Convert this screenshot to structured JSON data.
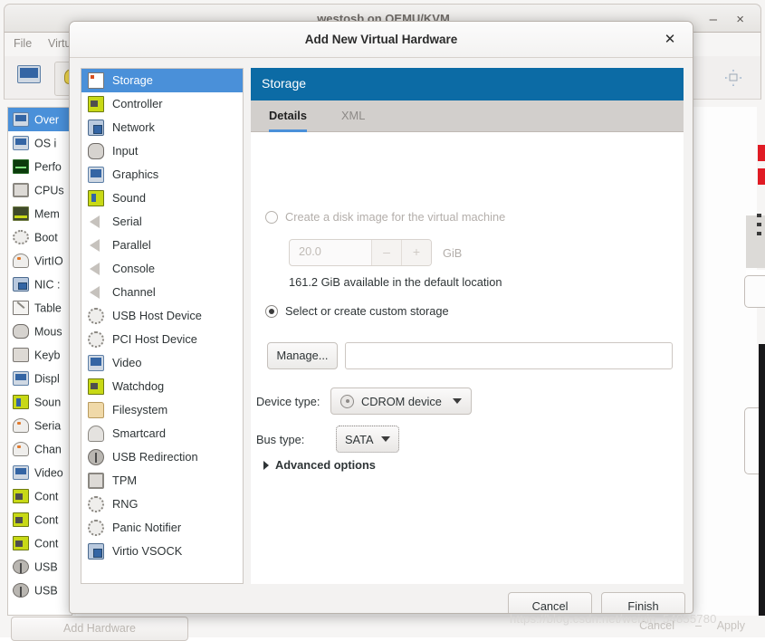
{
  "background_window": {
    "title": "westosb on QEMU/KVM",
    "minimize_label": "–",
    "close_label": "×",
    "menus": [
      "File",
      "Virtu"
    ],
    "toolbar_icons": [
      "monitor-icon",
      "lightbulb-icon",
      "fullscreen-icon"
    ],
    "hardware_list": [
      {
        "label": "Over",
        "icon": "monitor-icon",
        "selected": true
      },
      {
        "label": "OS i",
        "icon": "monitor-icon",
        "selected": false
      },
      {
        "label": "Perfo",
        "icon": "performance-icon",
        "selected": false
      },
      {
        "label": "CPUs",
        "icon": "cpu-chip-icon",
        "selected": false
      },
      {
        "label": "Mem",
        "icon": "memory-icon",
        "selected": false
      },
      {
        "label": "Boot",
        "icon": "gears-icon",
        "selected": false
      },
      {
        "label": "VirtIO",
        "icon": "disk-icon",
        "selected": false
      },
      {
        "label": "NIC :",
        "icon": "network-icon",
        "selected": false
      },
      {
        "label": "Table",
        "icon": "tablet-icon",
        "selected": false
      },
      {
        "label": "Mous",
        "icon": "mouse-icon",
        "selected": false
      },
      {
        "label": "Keyb",
        "icon": "keyboard-icon",
        "selected": false
      },
      {
        "label": "Displ",
        "icon": "monitor-icon",
        "selected": false
      },
      {
        "label": "Soun",
        "icon": "sound-icon",
        "selected": false
      },
      {
        "label": "Seria",
        "icon": "serial-icon",
        "selected": false
      },
      {
        "label": "Chan",
        "icon": "channel-icon",
        "selected": false
      },
      {
        "label": "Video",
        "icon": "monitor-icon",
        "selected": false
      },
      {
        "label": "Cont",
        "icon": "controller-icon",
        "selected": false
      },
      {
        "label": "Cont",
        "icon": "controller-icon",
        "selected": false
      },
      {
        "label": "Cont",
        "icon": "controller-icon",
        "selected": false
      },
      {
        "label": "USB",
        "icon": "usb-icon",
        "selected": false
      },
      {
        "label": "USB",
        "icon": "usb-icon",
        "selected": false
      }
    ],
    "add_hardware_label": "Add Hardware",
    "cancel_label": "Cancel",
    "apply_label": "Apply",
    "apply_prefix": "–"
  },
  "dialog": {
    "title": "Add New Virtual Hardware",
    "close_label": "✕",
    "hardware_types": [
      {
        "label": "Storage",
        "icon": "storage-icon",
        "selected": true
      },
      {
        "label": "Controller",
        "icon": "controller-icon",
        "selected": false
      },
      {
        "label": "Network",
        "icon": "network-icon",
        "selected": false
      },
      {
        "label": "Input",
        "icon": "mouse-icon",
        "selected": false
      },
      {
        "label": "Graphics",
        "icon": "monitor-icon",
        "selected": false
      },
      {
        "label": "Sound",
        "icon": "sound-icon",
        "selected": false
      },
      {
        "label": "Serial",
        "icon": "speaker-icon",
        "selected": false
      },
      {
        "label": "Parallel",
        "icon": "speaker-icon",
        "selected": false
      },
      {
        "label": "Console",
        "icon": "speaker-icon",
        "selected": false
      },
      {
        "label": "Channel",
        "icon": "speaker-icon",
        "selected": false
      },
      {
        "label": "USB Host Device",
        "icon": "gears-icon",
        "selected": false
      },
      {
        "label": "PCI Host Device",
        "icon": "gears-icon",
        "selected": false
      },
      {
        "label": "Video",
        "icon": "monitor-icon",
        "selected": false
      },
      {
        "label": "Watchdog",
        "icon": "controller-icon",
        "selected": false
      },
      {
        "label": "Filesystem",
        "icon": "folder-icon",
        "selected": false
      },
      {
        "label": "Smartcard",
        "icon": "smartcard-icon",
        "selected": false
      },
      {
        "label": "USB Redirection",
        "icon": "usb-icon",
        "selected": false
      },
      {
        "label": "TPM",
        "icon": "chip-icon",
        "selected": false
      },
      {
        "label": "RNG",
        "icon": "gears-icon",
        "selected": false
      },
      {
        "label": "Panic Notifier",
        "icon": "gears-icon",
        "selected": false
      },
      {
        "label": "Virtio VSOCK",
        "icon": "network-icon",
        "selected": false
      }
    ],
    "pane": {
      "header_title": "Storage",
      "tabs": [
        {
          "label": "Details",
          "active": true
        },
        {
          "label": "XML",
          "active": false
        }
      ],
      "create_disk": {
        "radio_label": "Create a disk image for the virtual machine",
        "selected": false,
        "enabled": false,
        "size_value": "20.0",
        "decrement_label": "–",
        "increment_label": "+",
        "unit_label": "GiB",
        "available_text": "161.2 GiB available in the default location"
      },
      "custom_storage": {
        "radio_label": "Select or create custom storage",
        "selected": true,
        "manage_label": "Manage...",
        "path_value": "",
        "path_placeholder": ""
      },
      "device_type": {
        "label": "Device type:",
        "value": "CDROM device",
        "icon": "cdrom-icon"
      },
      "bus_type": {
        "label": "Bus type:",
        "value": "SATA"
      },
      "advanced_options": {
        "label": "Advanced options",
        "expanded": false
      }
    },
    "buttons": {
      "cancel_label": "Cancel",
      "finish_label": "Finish"
    }
  },
  "watermark": {
    "text": "https://blog.csdn.net/weixin_54855780"
  },
  "colors": {
    "header_blue": "#0c6ba5",
    "selection_blue": "#4a90d9",
    "dialog_bg": "#f3f2f1",
    "pane_bg": "#ffffff",
    "tabstrip_bg": "#d2cfcc",
    "accent_red": "#e01b24"
  }
}
